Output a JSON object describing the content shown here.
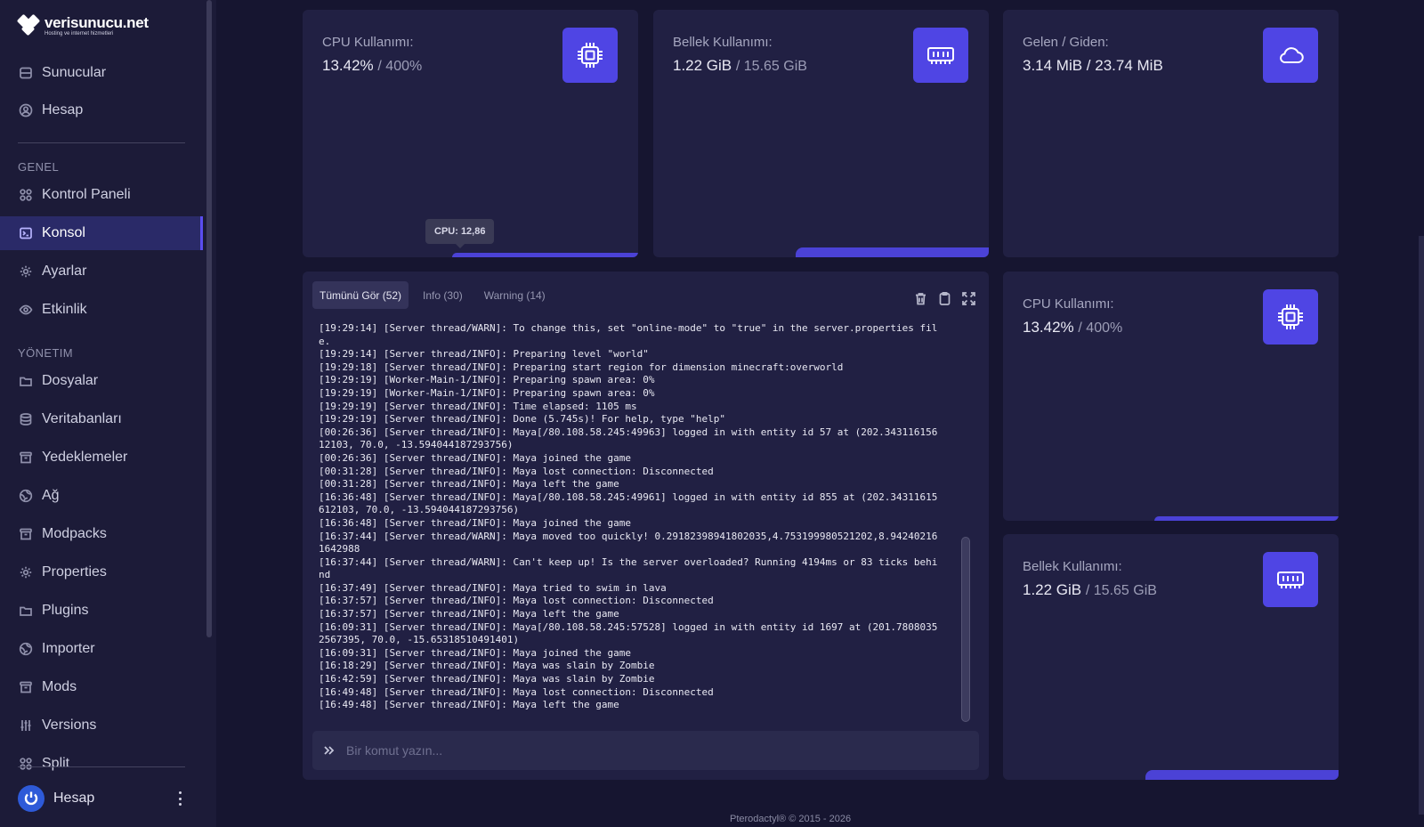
{
  "brand": {
    "name": "verisunucu.net",
    "tagline": "Hosting ve internet hizmetleri"
  },
  "nav_top": [
    {
      "label": "Sunucular",
      "icon": "server-icon"
    },
    {
      "label": "Hesap",
      "icon": "user-circle-icon"
    }
  ],
  "section_general": "GENEL",
  "nav_general": [
    {
      "label": "Kontrol Paneli",
      "icon": "grid-icon"
    },
    {
      "label": "Konsol",
      "icon": "terminal-icon",
      "active": true
    },
    {
      "label": "Ayarlar",
      "icon": "gear-icon"
    },
    {
      "label": "Etkinlik",
      "icon": "eye-icon"
    }
  ],
  "section_management": "YÖNETIM",
  "nav_management": [
    {
      "label": "Dosyalar",
      "icon": "folder-icon"
    },
    {
      "label": "Veritabanları",
      "icon": "database-icon"
    },
    {
      "label": "Yedeklemeler",
      "icon": "archive-icon"
    },
    {
      "label": "Ağ",
      "icon": "globe-icon"
    },
    {
      "label": "Modpacks",
      "icon": "archive-icon"
    },
    {
      "label": "Properties",
      "icon": "gear-icon"
    },
    {
      "label": "Plugins",
      "icon": "folder-icon"
    },
    {
      "label": "Importer",
      "icon": "globe-icon"
    },
    {
      "label": "Mods",
      "icon": "archive-icon"
    },
    {
      "label": "Versions",
      "icon": "sliders-icon"
    },
    {
      "label": "Split",
      "icon": "grid-icon"
    }
  ],
  "user": {
    "label": "Hesap"
  },
  "cards": {
    "cpu_top": {
      "label": "CPU Kullanımı:",
      "value": "13.42%",
      "limit": "/ 400%",
      "tooltip": "CPU: 12,86"
    },
    "mem_top": {
      "label": "Bellek Kullanımı:",
      "value": "1.22 GiB",
      "limit": "/ 15.65 GiB"
    },
    "net": {
      "label": "Gelen / Giden:",
      "value": "3.14 MiB / 23.74 MiB"
    },
    "cpu_side": {
      "label": "CPU Kullanımı:",
      "value": "13.42%",
      "limit": "/ 400%"
    },
    "mem_side": {
      "label": "Bellek Kullanımı:",
      "value": "1.22 GiB",
      "limit": "/ 15.65 GiB"
    }
  },
  "console": {
    "tabs": [
      "Tümünü Gör (52)",
      "Info (30)",
      "Warning (14)"
    ],
    "lines": [
      "[19:29:14] [Server thread/WARN]: To change this, set \"online-mode\" to \"true\" in the server.properties fil",
      "e.",
      "[19:29:14] [Server thread/INFO]: Preparing level \"world\"",
      "[19:29:18] [Server thread/INFO]: Preparing start region for dimension minecraft:overworld",
      "[19:29:19] [Worker-Main-1/INFO]: Preparing spawn area: 0%",
      "[19:29:19] [Worker-Main-1/INFO]: Preparing spawn area: 0%",
      "[19:29:19] [Server thread/INFO]: Time elapsed: 1105 ms",
      "[19:29:19] [Server thread/INFO]: Done (5.745s)! For help, type \"help\"",
      "[00:26:36] [Server thread/INFO]: Maya[/80.108.58.245:49963] logged in with entity id 57 at (202.343116156",
      "12103, 70.0, -13.594044187293756)",
      "[00:26:36] [Server thread/INFO]: Maya joined the game",
      "[00:31:28] [Server thread/INFO]: Maya lost connection: Disconnected",
      "[00:31:28] [Server thread/INFO]: Maya left the game",
      "[16:36:48] [Server thread/INFO]: Maya[/80.108.58.245:49961] logged in with entity id 855 at (202.34311615",
      "612103, 70.0, -13.594044187293756)",
      "[16:36:48] [Server thread/INFO]: Maya joined the game",
      "[16:37:44] [Server thread/WARN]: Maya moved too quickly! 0.29182398941802035,4.753199980521202,8.94240216",
      "1642988",
      "[16:37:44] [Server thread/WARN]: Can't keep up! Is the server overloaded? Running 4194ms or 83 ticks behi",
      "nd",
      "[16:37:49] [Server thread/INFO]: Maya tried to swim in lava",
      "[16:37:57] [Server thread/INFO]: Maya lost connection: Disconnected",
      "[16:37:57] [Server thread/INFO]: Maya left the game",
      "[16:09:31] [Server thread/INFO]: Maya[/80.108.58.245:57528] logged in with entity id 1697 at (201.7808035",
      "2567395, 70.0, -15.65318510491401)",
      "[16:09:31] [Server thread/INFO]: Maya joined the game",
      "[16:18:29] [Server thread/INFO]: Maya was slain by Zombie",
      "[16:42:59] [Server thread/INFO]: Maya was slain by Zombie",
      "[16:49:48] [Server thread/INFO]: Maya lost connection: Disconnected",
      "[16:49:48] [Server thread/INFO]: Maya left the game"
    ],
    "command_placeholder": "Bir komut yazın..."
  },
  "footer": "Pterodactyl® © 2015 - 2026",
  "colors": {
    "accent": "#4f45e4",
    "background": "#161530",
    "card": "#212043",
    "sidebar": "#1c1b38"
  }
}
